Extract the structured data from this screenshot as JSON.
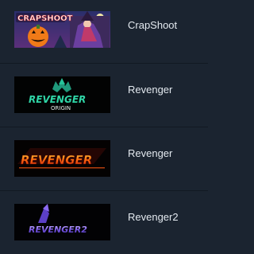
{
  "games": [
    {
      "title": "CrapShoot",
      "thumbnail_text": "CRAPSHOOT",
      "icon": "crapshoot-thumbnail"
    },
    {
      "title": "Revenger",
      "thumbnail_text": "REVENGER",
      "thumbnail_subtext": "ORIGIN",
      "icon": "revenger-origin-thumbnail"
    },
    {
      "title": "Revenger",
      "thumbnail_text": "REVENGER",
      "icon": "revenger-thumbnail"
    },
    {
      "title": "Revenger2",
      "thumbnail_text": "REVENGER2",
      "icon": "revenger2-thumbnail"
    }
  ],
  "colors": {
    "background": "#1b2430",
    "divider": "#121922",
    "text": "#e3e9ef"
  }
}
